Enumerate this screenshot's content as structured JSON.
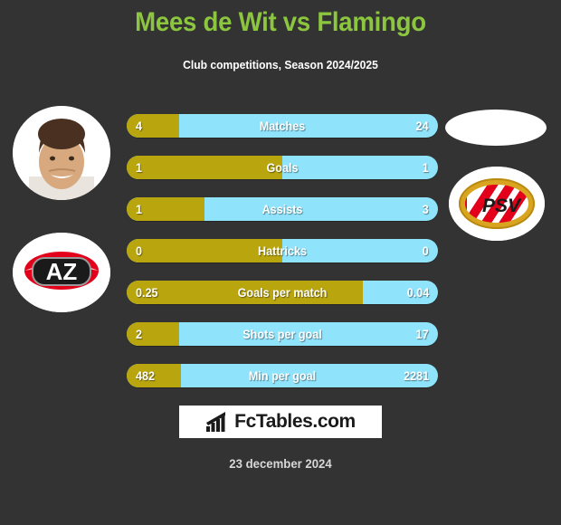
{
  "header": {
    "title": "Mees de Wit vs Flamingo",
    "subtitle": "Club competitions, Season 2024/2025",
    "title_color": "#8cc63f"
  },
  "colors": {
    "background": "#333333",
    "left_bar": "#b9a50e",
    "right_bar": "#8fe3fb",
    "text": "#ffffff"
  },
  "media": {
    "left_player_photo": "player-photo",
    "right_player_photo": "player-photo-placeholder",
    "left_club_crest": "az-alkmaar-crest",
    "right_club_crest": "psv-eindhoven-crest",
    "left_crest_text": "AZ",
    "right_crest_text": "PSV"
  },
  "chart_data": {
    "type": "bar",
    "title": "Mees de Wit vs Flamingo",
    "subtitle": "Club competitions, Season 2024/2025",
    "orientation": "horizontal-diverging",
    "series": [
      {
        "name": "Mees de Wit",
        "color": "#b9a50e",
        "side": "left"
      },
      {
        "name": "Flamingo",
        "color": "#8fe3fb",
        "side": "right"
      }
    ],
    "categories": [
      "Matches",
      "Goals",
      "Assists",
      "Hattricks",
      "Goals per match",
      "Shots per goal",
      "Min per goal"
    ],
    "rows": [
      {
        "label": "Matches",
        "left": "4",
        "right": "24",
        "left_pct": 17
      },
      {
        "label": "Goals",
        "left": "1",
        "right": "1",
        "left_pct": 50
      },
      {
        "label": "Assists",
        "left": "1",
        "right": "3",
        "left_pct": 25
      },
      {
        "label": "Hattricks",
        "left": "0",
        "right": "0",
        "left_pct": 50
      },
      {
        "label": "Goals per match",
        "left": "0.25",
        "right": "0.04",
        "left_pct": 76
      },
      {
        "label": "Shots per goal",
        "left": "2",
        "right": "17",
        "left_pct": 17
      },
      {
        "label": "Min per goal",
        "left": "482",
        "right": "2281",
        "left_pct": 17.5
      }
    ]
  },
  "footer": {
    "brand": "FcTables.com",
    "brand_icon": "bar-chart-icon",
    "date": "23 december 2024"
  }
}
